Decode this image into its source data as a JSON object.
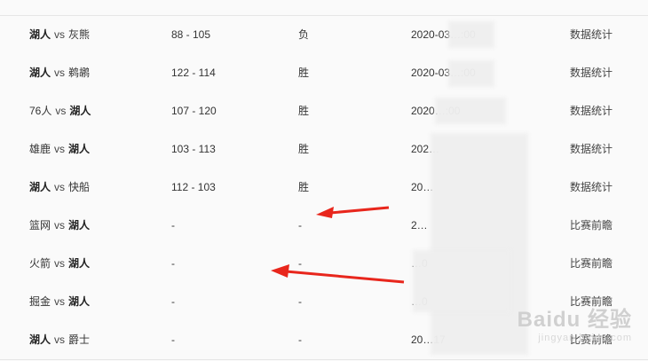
{
  "header": {
    "match": "",
    "score": "",
    "result": "",
    "time": ""
  },
  "rows": [
    {
      "home": "湖人",
      "away": "灰熊",
      "home_bold": true,
      "away_bold": false,
      "vs": "vs",
      "score": "88 - 105",
      "result": "负",
      "time": "2020-03…:00",
      "action": "数据统计"
    },
    {
      "home": "湖人",
      "away": "鹈鹕",
      "home_bold": true,
      "away_bold": false,
      "vs": "vs",
      "score": "122 - 114",
      "result": "胜",
      "time": "2020-03…:00",
      "action": "数据统计"
    },
    {
      "home": "76人",
      "away": "湖人",
      "home_bold": false,
      "away_bold": true,
      "vs": "vs",
      "score": "107 - 120",
      "result": "胜",
      "time": "2020…:00",
      "action": "数据统计"
    },
    {
      "home": "雄鹿",
      "away": "湖人",
      "home_bold": false,
      "away_bold": true,
      "vs": "vs",
      "score": "103 - 113",
      "result": "胜",
      "time": "202…",
      "action": "数据统计"
    },
    {
      "home": "湖人",
      "away": "快船",
      "home_bold": true,
      "away_bold": false,
      "vs": "vs",
      "score": "112 - 103",
      "result": "胜",
      "time": "20…",
      "action": "数据统计"
    },
    {
      "home": "篮网",
      "away": "湖人",
      "home_bold": false,
      "away_bold": true,
      "vs": "vs",
      "score": "-",
      "result": "-",
      "time": "2…",
      "action": "比赛前瞻"
    },
    {
      "home": "火箭",
      "away": "湖人",
      "home_bold": false,
      "away_bold": true,
      "vs": "vs",
      "score": "-",
      "result": "-",
      "time": "…0",
      "action": "比赛前瞻"
    },
    {
      "home": "掘金",
      "away": "湖人",
      "home_bold": false,
      "away_bold": true,
      "vs": "vs",
      "score": "-",
      "result": "-",
      "time": "…0",
      "action": "比赛前瞻"
    },
    {
      "home": "湖人",
      "away": "爵士",
      "home_bold": true,
      "away_bold": false,
      "vs": "vs",
      "score": "-",
      "result": "-",
      "time": "20…17",
      "action": "比赛前瞻"
    }
  ],
  "watermark": {
    "logo": "Baidu 经验",
    "url": "jingyan.baidu.com"
  },
  "colors": {
    "arrow": "#e8261c",
    "border": "#e6e6e6",
    "background": "#fafafa"
  }
}
